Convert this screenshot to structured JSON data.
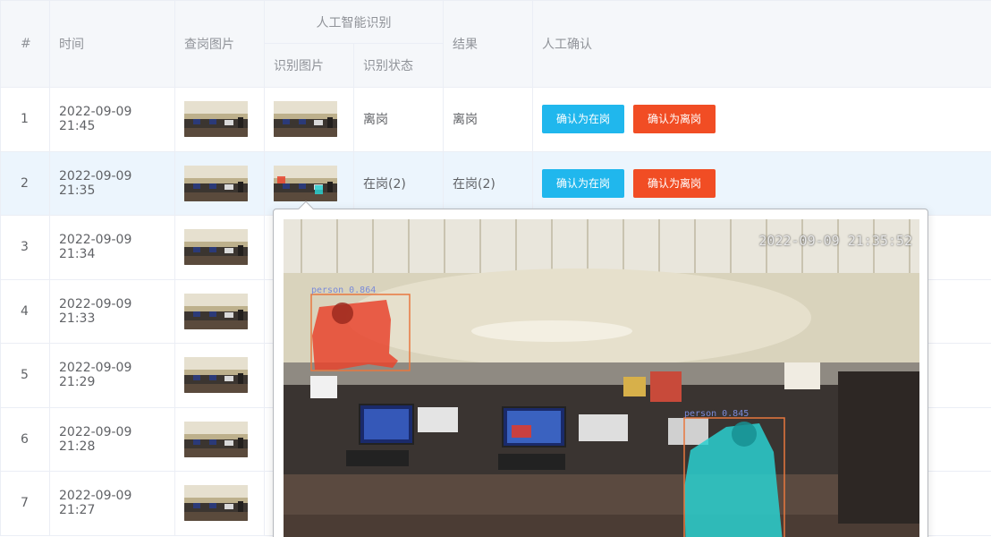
{
  "table": {
    "headers": {
      "index": "#",
      "time": "时间",
      "check_image": "查岗图片",
      "ai_group": "人工智能识别",
      "ai_image": "识别图片",
      "ai_status": "识别状态",
      "result": "结果",
      "manual": "人工确认"
    },
    "rows": [
      {
        "index": "1",
        "time": "2022-09-09 21:45",
        "status": "离岗",
        "result": "离岗",
        "confirm_on": "确认为在岗",
        "confirm_off": "确认为离岗"
      },
      {
        "index": "2",
        "time": "2022-09-09 21:35",
        "status": "在岗(2)",
        "result": "在岗(2)",
        "confirm_on": "确认为在岗",
        "confirm_off": "确认为离岗"
      },
      {
        "index": "3",
        "time": "2022-09-09 21:34"
      },
      {
        "index": "4",
        "time": "2022-09-09 21:33"
      },
      {
        "index": "5",
        "time": "2022-09-09 21:29"
      },
      {
        "index": "6",
        "time": "2022-09-09 21:28"
      },
      {
        "index": "7",
        "time": "2022-09-09 21:27"
      }
    ]
  },
  "popover": {
    "timestamp": "2022-09-09 21:35:52",
    "detections": [
      {
        "label": "person 0.864",
        "color": "#e8442e"
      },
      {
        "label": "person 0.845",
        "color": "#2ad0d0"
      }
    ]
  },
  "colors": {
    "confirm_on": "#20b7ed",
    "confirm_off": "#f14d24",
    "highlight_row": "#ecf5fd",
    "header_bg": "#f5f7fa"
  }
}
